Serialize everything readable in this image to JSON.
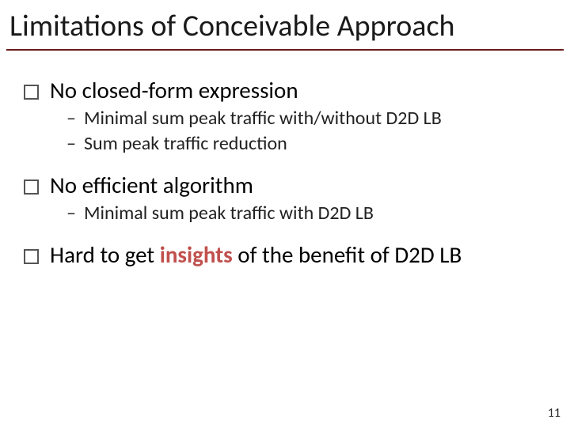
{
  "title": "Limitations of  Conceivable Approach",
  "bullets": {
    "b1": "No closed-form expression",
    "b1_sub": {
      "s1": "Minimal sum peak traffic with/without D2D LB",
      "s2": "Sum peak traffic reduction"
    },
    "b2": "No efficient algorithm",
    "b2_sub": {
      "s1": "Minimal sum peak traffic with D2D LB"
    },
    "b3_pre": "Hard to get ",
    "b3_accent": "insights",
    "b3_post": " of the benefit of D2D LB"
  },
  "dash": "–",
  "page_number": "11"
}
